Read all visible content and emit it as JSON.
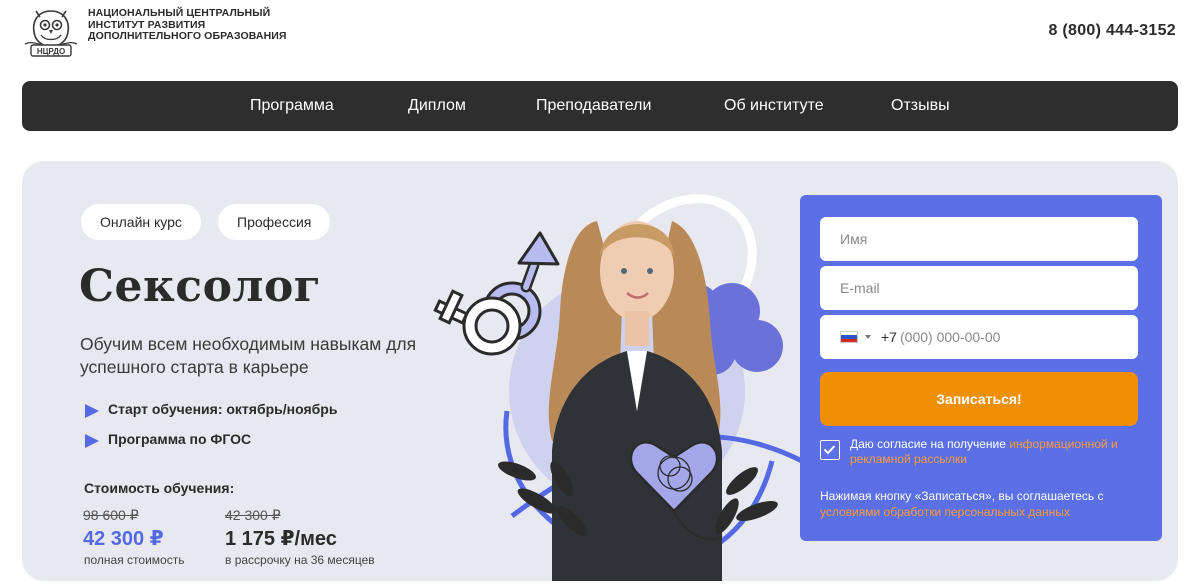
{
  "header": {
    "logo_text": "НЦРДО",
    "org_name": "НАЦИОНАЛЬНЫЙ ЦЕНТРАЛЬНЫЙ ИНСТИТУТ РАЗВИТИЯ ДОПОЛНИТЕЛЬНОГО ОБРАЗОВАНИЯ",
    "phone": "8 (800) 444-3152"
  },
  "nav": {
    "items": [
      {
        "label": "Программа"
      },
      {
        "label": "Диплом"
      },
      {
        "label": "Преподаватели"
      },
      {
        "label": "Об институте"
      },
      {
        "label": "Отзывы"
      }
    ]
  },
  "hero": {
    "chips": [
      "Онлайн курс",
      "Профессия"
    ],
    "title": "Сексолог",
    "subtitle": "Обучим всем необходимым навыкам для успешного старта в карьере",
    "bullets": [
      "Старт обучения: октябрь/ноябрь",
      "Программа по ФГОС"
    ],
    "cost_label": "Стоимость обучения:",
    "full": {
      "old_price": "98 600 ₽",
      "new_price": "42 300 ₽",
      "note": "полная стоимость"
    },
    "installment": {
      "old_price": "42 300 ₽",
      "price": "1 175 ₽/мес",
      "note": "в рассрочку на 36 месяцев"
    }
  },
  "form": {
    "name_placeholder": "Имя",
    "email_placeholder": "E-mail",
    "country_code": "+7",
    "phone_placeholder": "(000) 000-00-00",
    "submit_label": "Записаться!",
    "consent_prefix": "Даю согласие на получение ",
    "consent_link": "информационной и рекламной рассылки",
    "disclaimer_prefix": "Нажимая кнопку «Записаться», вы соглашаетесь с ",
    "disclaimer_link": "условиями обработки персональных данных",
    "checkbox_checked": true
  },
  "colors": {
    "accent_blue": "#5469e3",
    "form_bg": "#5b70e6",
    "button_orange": "#ef8f06",
    "nav_bg": "#2e2e2e",
    "hero_bg": "#e7e8f0"
  }
}
